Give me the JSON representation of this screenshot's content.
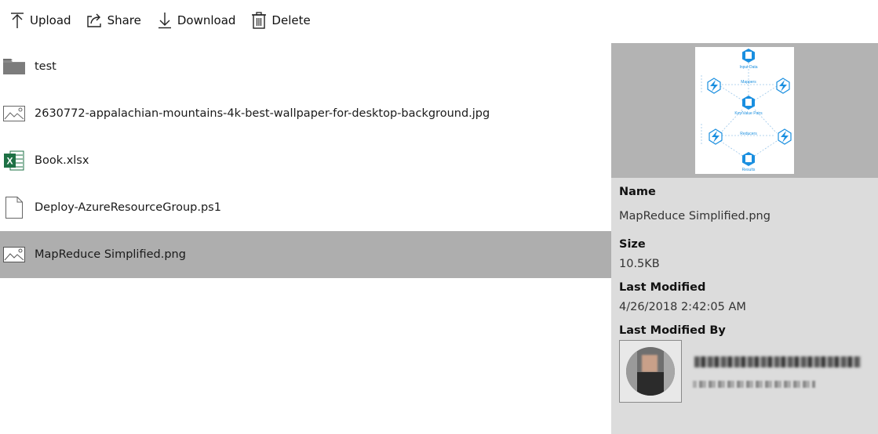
{
  "toolbar": {
    "upload_label": "Upload",
    "share_label": "Share",
    "download_label": "Download",
    "delete_label": "Delete"
  },
  "files": [
    {
      "name": "test",
      "icon": "folder-icon"
    },
    {
      "name": "2630772-appalachian-mountains-4k-best-wallpaper-for-desktop-background.jpg",
      "icon": "image-file-icon"
    },
    {
      "name": "Book.xlsx",
      "icon": "excel-file-icon"
    },
    {
      "name": "Deploy-AzureResourceGroup.ps1",
      "icon": "document-file-icon"
    },
    {
      "name": "MapReduce Simplified.png",
      "icon": "image-file-icon",
      "selected": true
    }
  ],
  "preview": {
    "labels": [
      "Input Data",
      "Mappers",
      "Key/Value Pairs",
      "Reducers",
      "Results"
    ]
  },
  "details": {
    "name_label": "Name",
    "name_value": "MapReduce Simplified.png",
    "size_label": "Size",
    "size_value": "10.5KB",
    "modified_label": "Last Modified",
    "modified_value": "4/26/2018 2:42:05 AM",
    "modified_by_label": "Last Modified By"
  },
  "colors": {
    "selected_row": "#aeaeae",
    "panel_bg": "#dcdcdc",
    "preview_bg": "#b3b3b3",
    "azure_blue": "#1a8fe0",
    "excel_green": "#1e7145"
  }
}
